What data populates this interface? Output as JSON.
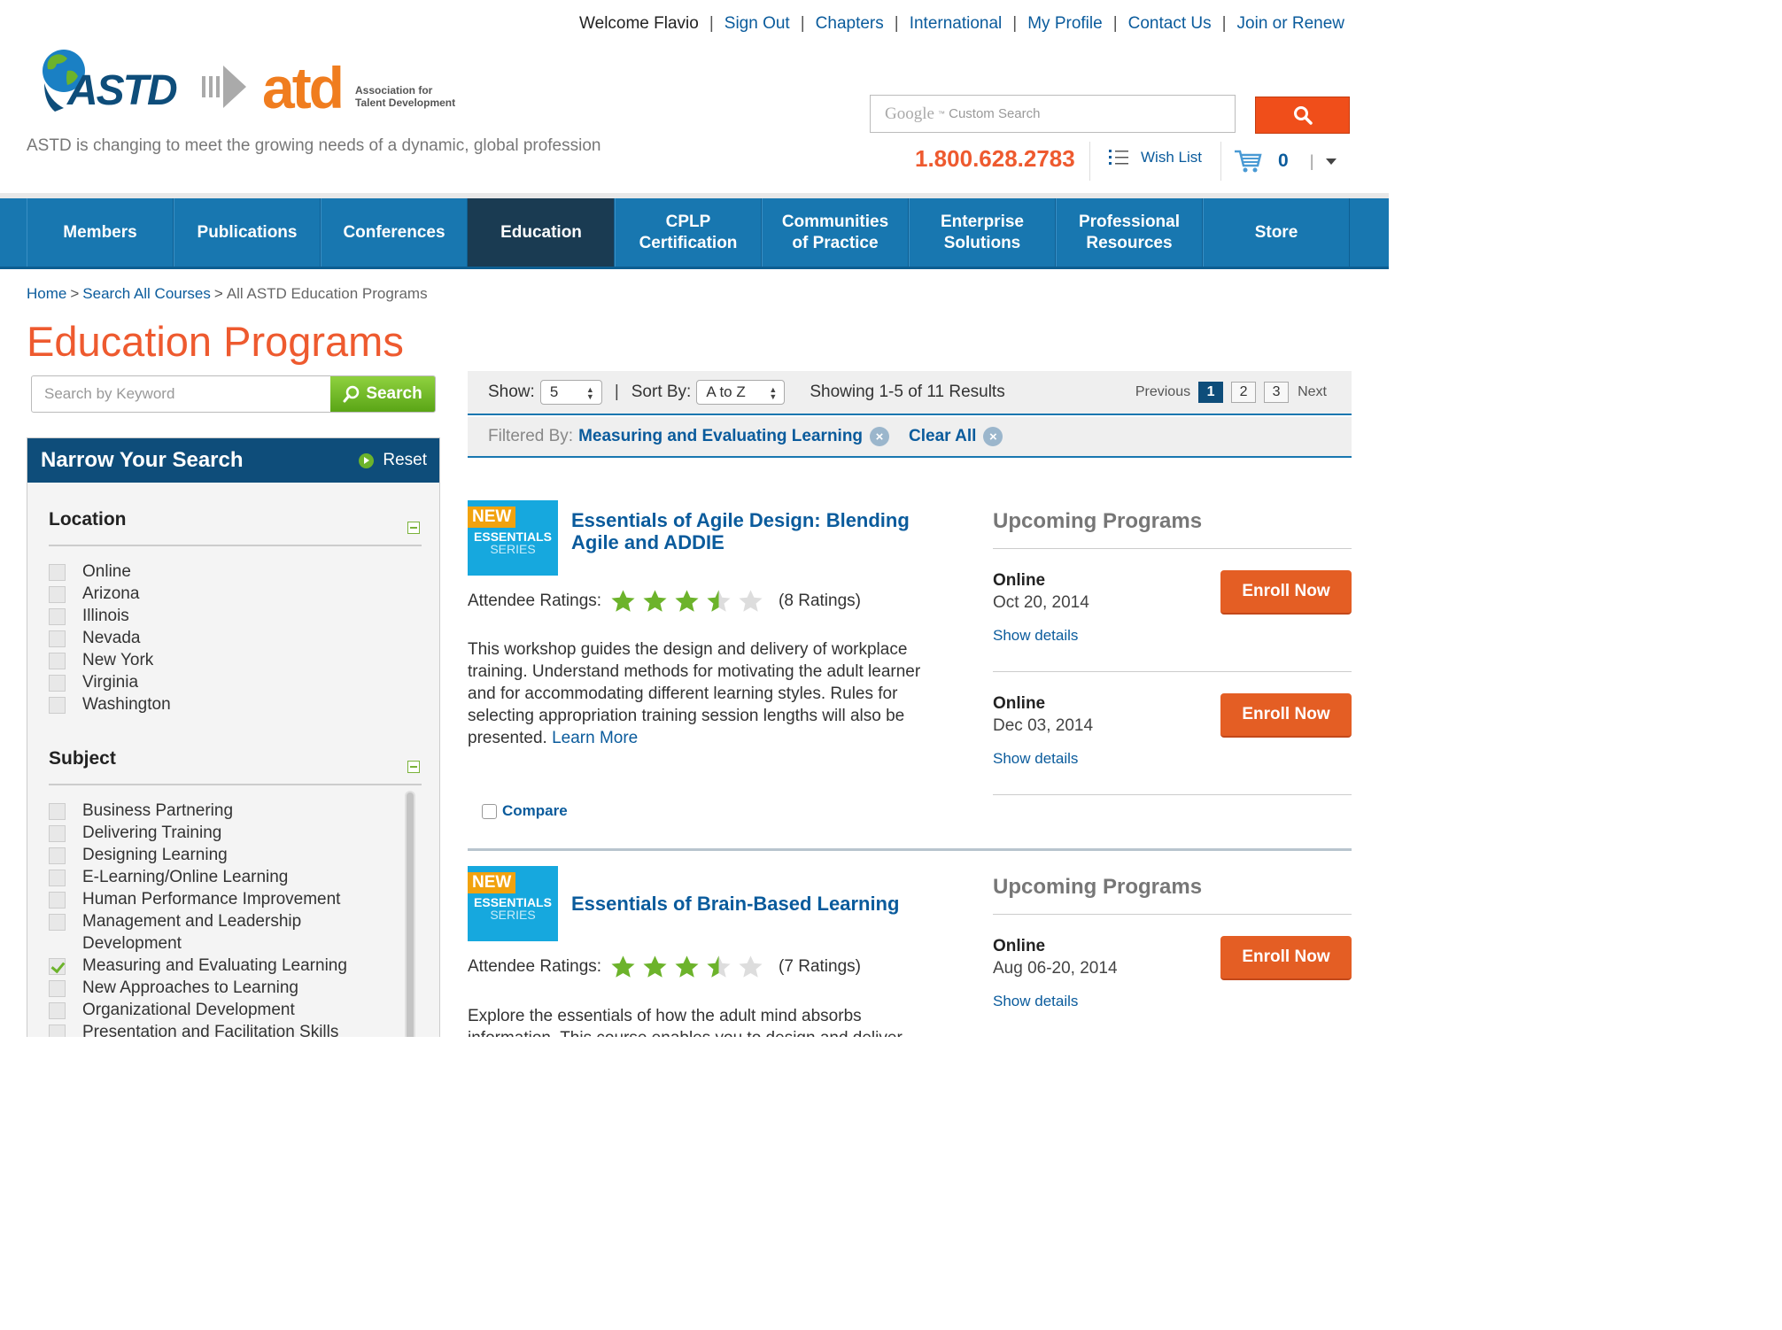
{
  "top_nav": {
    "welcome": "Welcome Flavio",
    "links": [
      "Sign Out",
      "Chapters",
      "International",
      "My Profile",
      "Contact Us",
      "Join or Renew"
    ]
  },
  "logo": {
    "astd": "ASTD",
    "atd": "atd",
    "atd_sub_1": "Association for",
    "atd_sub_2": "Talent Development"
  },
  "tagline": "ASTD is changing to meet the growing needs of a dynamic, global profession",
  "site_search": {
    "google": "Google",
    "placeholder": "Custom Search",
    "button_icon": "search-icon"
  },
  "phone": "1.800.628.2783",
  "wish_list": "Wish List",
  "cart": {
    "count": "0"
  },
  "main_nav": [
    "Members",
    "Publications",
    "Conferences",
    "Education",
    "CPLP\nCertification",
    "Communities\nof Practice",
    "Enterprise\nSolutions",
    "Professional\nResources",
    "Store"
  ],
  "main_nav_active": "Education",
  "breadcrumb": [
    "Home",
    "Search All Courses",
    "All ASTD Education Programs"
  ],
  "page_title": "Education Programs",
  "keyword_search": {
    "placeholder": "Search by Keyword",
    "button": "Search"
  },
  "sidebar": {
    "title": "Narrow Your Search",
    "reset": "Reset",
    "location": {
      "title": "Location",
      "items": [
        "Online",
        "Arizona",
        "Illinois",
        "Nevada",
        "New York",
        "Virginia",
        "Washington"
      ]
    },
    "subject": {
      "title": "Subject",
      "items": [
        "Business Partnering",
        "Delivering Training",
        "Designing Learning",
        "E-Learning/Online Learning",
        "Human Performance Improvement",
        "Management and Leadership Development",
        "Measuring and Evaluating Learning",
        "New Approaches to Learning",
        "Organizational Development",
        "Presentation and Facilitation Skills"
      ],
      "checked": "Measuring and Evaluating Learning"
    }
  },
  "toolbar": {
    "show_label": "Show:",
    "show_value": "5",
    "sort_label": "Sort By:",
    "sort_value": "A to Z",
    "results_text": "Showing 1-5 of 11 Results",
    "previous": "Previous",
    "pages": [
      "1",
      "2",
      "3"
    ],
    "current_page": "1",
    "next": "Next"
  },
  "filter": {
    "label": "Filtered By:",
    "value": "Measuring and Evaluating Learning",
    "clear": "Clear All"
  },
  "courses": [
    {
      "badge_new": "NEW",
      "badge_line1": "ESSENTIALS",
      "badge_line2": "SERIES",
      "title": "Essentials of Agile Design: Blending Agile and ADDIE",
      "ratings_label": "Attendee Ratings:",
      "rating": 3.5,
      "ratings_count": "(8 Ratings)",
      "description": "This workshop guides the design and delivery of workplace training. Understand methods for motivating the adult learner and for accommodating different learning styles.  Rules for selecting appropriation training session lengths will also be presented.",
      "learn_more": "Learn More",
      "compare": "Compare",
      "upcoming_title": "Upcoming Programs",
      "sessions": [
        {
          "location": "Online",
          "date": "Oct 20, 2014",
          "details": "Show details",
          "button": "Enroll Now"
        },
        {
          "location": "Online",
          "date": "Dec 03, 2014",
          "details": "Show details",
          "button": "Enroll Now"
        }
      ]
    },
    {
      "badge_new": "NEW",
      "badge_line1": "ESSENTIALS",
      "badge_line2": "SERIES",
      "title": "Essentials of Brain-Based Learning",
      "ratings_label": "Attendee Ratings:",
      "rating": 3.5,
      "ratings_count": "(7 Ratings)",
      "description": "Explore the essentials of how the adult mind absorbs information.  This course enables you to design and deliver",
      "upcoming_title": "Upcoming Programs",
      "sessions": [
        {
          "location": "Online",
          "date": "Aug 06-20, 2014",
          "details": "Show details",
          "button": "Enroll Now"
        }
      ]
    }
  ],
  "colors": {
    "accent_orange": "#ee5a2f",
    "nav_blue": "#1877b0",
    "nav_active": "#1a3b52",
    "link_blue": "#0a5b9c",
    "green": "#6cb32b"
  }
}
